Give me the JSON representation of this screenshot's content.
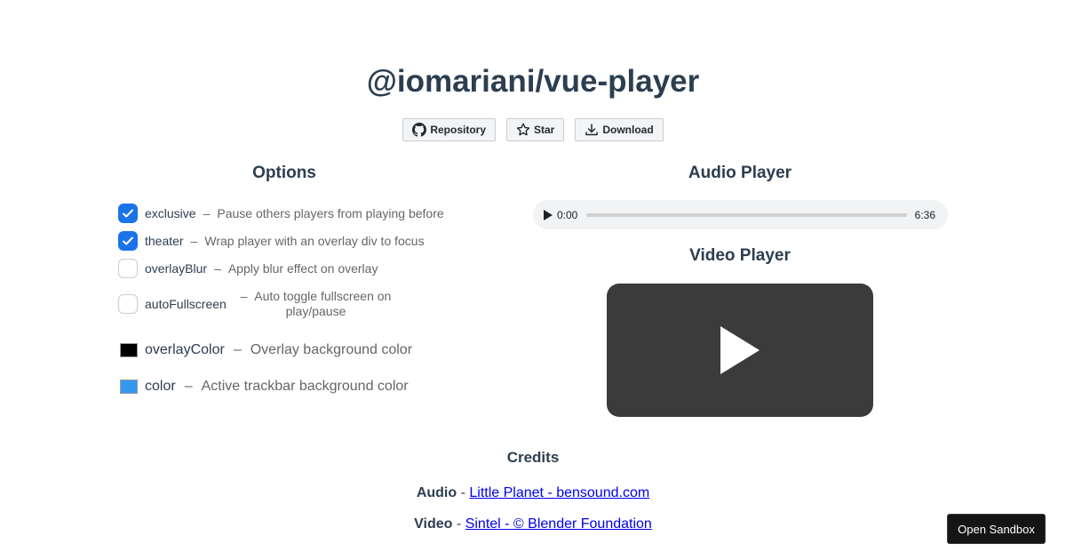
{
  "header": {
    "title": "@iomariani/vue-player",
    "buttons": {
      "repository": "Repository",
      "star": "Star",
      "download": "Download"
    }
  },
  "options": {
    "title": "Options",
    "separator": "–",
    "toggles": [
      {
        "name": "exclusive",
        "description": "Pause others players from playing before",
        "checked": true
      },
      {
        "name": "theater",
        "description": "Wrap player with an overlay div to focus",
        "checked": true
      },
      {
        "name": "overlayBlur",
        "description": "Apply blur effect on overlay",
        "checked": false
      },
      {
        "name": "autoFullscreen",
        "description": "Auto toggle fullscreen on play/pause",
        "checked": false
      }
    ],
    "colors": [
      {
        "name": "overlayColor",
        "description": "Overlay background color",
        "value": "#000000"
      },
      {
        "name": "color",
        "description": "Active trackbar background color",
        "value": "#3498f0"
      }
    ]
  },
  "audio_player": {
    "title": "Audio Player",
    "current_time": "0:00",
    "duration": "6:36",
    "progress": 0
  },
  "video_player": {
    "title": "Video Player"
  },
  "credits": {
    "title": "Credits",
    "audio_label": "Audio",
    "audio_link": "Little Planet - bensound.com",
    "video_label": "Video",
    "video_link": "Sintel - © Blender Foundation",
    "separator": "-"
  },
  "sandbox_button": "Open Sandbox",
  "colors": {
    "checkbox_on": "#1a73e8",
    "heading": "#2c3e50",
    "link": "#0000ee"
  }
}
